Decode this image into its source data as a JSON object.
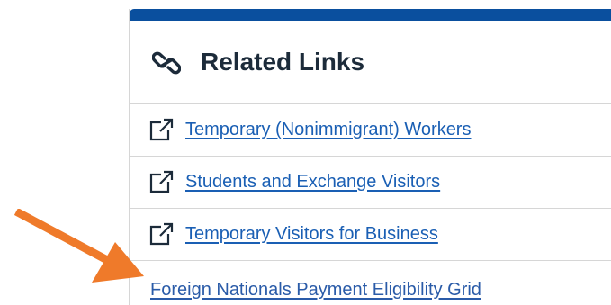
{
  "panel": {
    "title": "Related Links",
    "title_icon": "chain-link-icon",
    "accent_color": "#0a4f9e"
  },
  "links": [
    {
      "label": "Temporary (Nonimmigrant) Workers",
      "icon": "external-link-icon"
    },
    {
      "label": "Students and Exchange Visitors",
      "icon": "external-link-icon"
    },
    {
      "label": "Temporary Visitors for Business",
      "icon": "external-link-icon"
    },
    {
      "label": "Foreign Nationals Payment Eligibility Grid",
      "icon": ""
    }
  ],
  "annotation": {
    "arrow_color": "#ef7a2a",
    "arrow_icon": "pointer-arrow-icon"
  }
}
